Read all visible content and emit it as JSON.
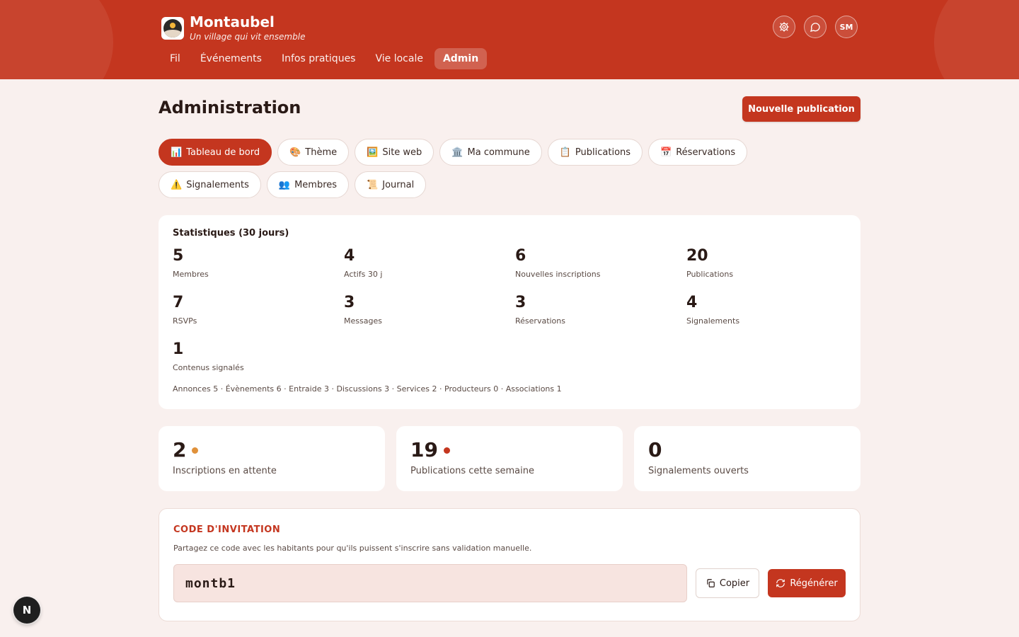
{
  "brand": {
    "name": "Montaubel",
    "tagline": "Un village qui vit ensemble"
  },
  "nav": [
    {
      "label": "Fil"
    },
    {
      "label": "Événements"
    },
    {
      "label": "Infos pratiques"
    },
    {
      "label": "Vie locale"
    },
    {
      "label": "Admin",
      "active": true
    }
  ],
  "header_actions": {
    "avatar_initials": "SM",
    "icons": [
      "gear-icon",
      "chat-bubble-icon"
    ]
  },
  "page": {
    "title": "Administration",
    "new_post_label": "Nouvelle publication"
  },
  "tabs": [
    {
      "icon": "📊",
      "label": "Tableau de bord",
      "active": true
    },
    {
      "icon": "🎨",
      "label": "Thème"
    },
    {
      "icon": "🖼️",
      "label": "Site web"
    },
    {
      "icon": "🏛️",
      "label": "Ma commune"
    },
    {
      "icon": "📋",
      "label": "Publications"
    },
    {
      "icon": "📅",
      "label": "Réservations"
    },
    {
      "icon": "⚠️",
      "label": "Signalements"
    },
    {
      "icon": "👥",
      "label": "Membres"
    },
    {
      "icon": "📜",
      "label": "Journal"
    }
  ],
  "stats": {
    "title": "Statistiques (30 jours)",
    "items": [
      {
        "value": "5",
        "label": "Membres"
      },
      {
        "value": "4",
        "label": "Actifs 30 j"
      },
      {
        "value": "6",
        "label": "Nouvelles inscriptions"
      },
      {
        "value": "20",
        "label": "Publications"
      },
      {
        "value": "7",
        "label": "RSVPs"
      },
      {
        "value": "3",
        "label": "Messages"
      },
      {
        "value": "3",
        "label": "Réservations"
      },
      {
        "value": "4",
        "label": "Signalements"
      },
      {
        "value": "1",
        "label": "Contenus signalés"
      }
    ],
    "breakdown": "Annonces 5 · Évènements 6 · Entraide 3 · Discussions 3 · Services 2 · Producteurs 0 · Associations 1"
  },
  "metrics": [
    {
      "value": "2",
      "label": "Inscriptions en attente",
      "dot_color": "#e0913a"
    },
    {
      "value": "19",
      "label": "Publications cette semaine",
      "dot_color": "#c4361f"
    },
    {
      "value": "0",
      "label": "Signalements ouverts"
    }
  ],
  "invite": {
    "title": "CODE D'INVITATION",
    "description": "Partagez ce code avec les habitants pour qu'ils puissent s'inscrire sans validation manuelle.",
    "code": "montb1",
    "copy_label": "Copier",
    "regen_label": "Régénérer"
  },
  "fab_label": "N",
  "colors": {
    "primary": "#c4361f",
    "background": "#f9f0ee",
    "pending_dot": "#e0913a"
  }
}
